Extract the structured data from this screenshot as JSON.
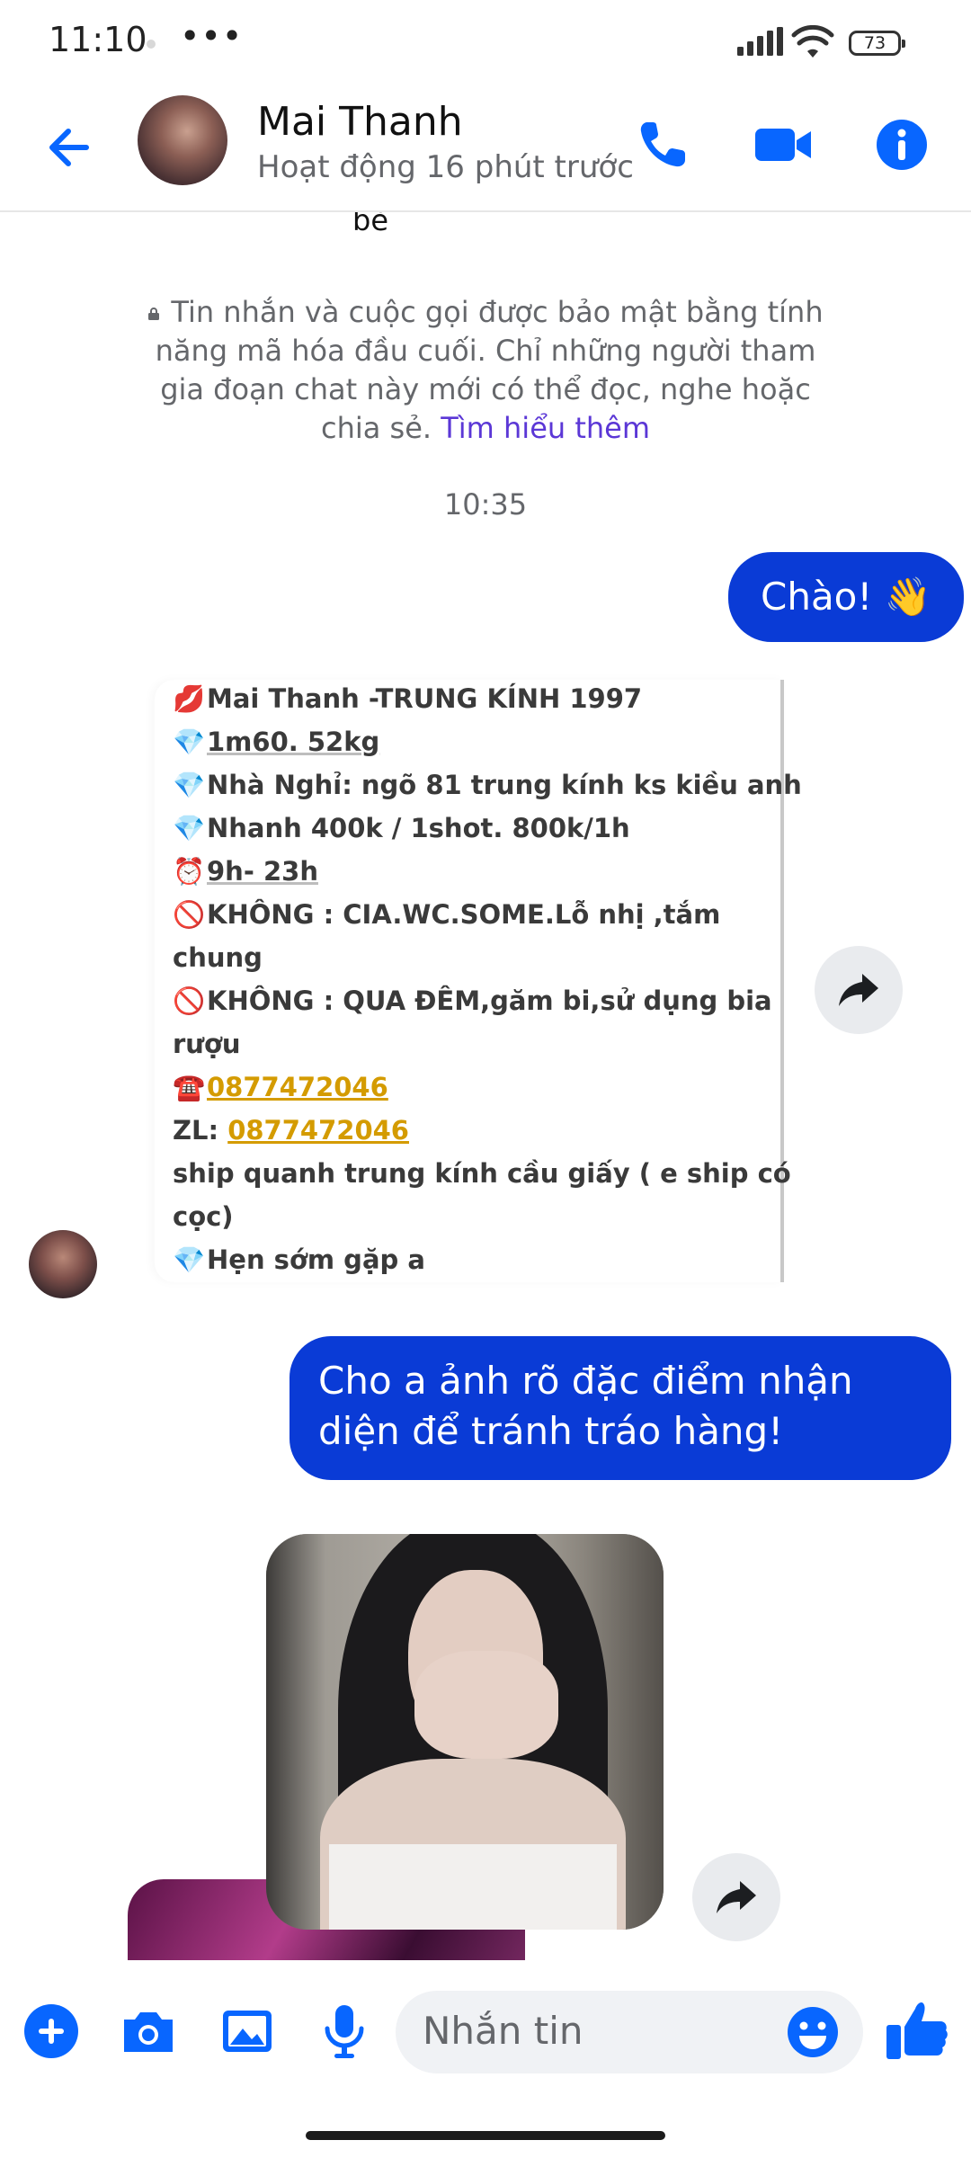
{
  "status_bar": {
    "time": "11:10",
    "more": "•••",
    "battery": "73"
  },
  "header": {
    "name": "Mai Thanh",
    "status": "Hoạt động 16 phút trước",
    "icons": [
      "back-arrow-icon",
      "phone-icon",
      "video-camera-icon",
      "info-icon"
    ]
  },
  "chat": {
    "cut_text": "bè",
    "e2e_notice": "Tin nhắn và cuộc gọi được bảo mật bằng tính năng mã hóa đầu cuối. Chỉ những người tham gia đoạn chat này mới có thể đọc, nghe hoặc chia sẻ.",
    "e2e_link": "Tìm hiểu thêm",
    "timestamp": "10:35",
    "msg_hello": "Chào! 👋",
    "forwarded_card": {
      "lines": [
        {
          "emo": "💋",
          "text": "Mai Thanh -TRUNG KÍNH 1997"
        },
        {
          "emo": "💎",
          "text": "1m60. 52kg"
        },
        {
          "emo": "💎",
          "text": "Nhà Nghỉ:  ngõ 81 trung kính ks kiều anh"
        },
        {
          "emo": "💎",
          "text": "Nhanh 400k / 1shot. 800k/1h"
        },
        {
          "emo": "⏰",
          "text": "9h- 23h"
        },
        {
          "emo": "🚫",
          "text": "KHÔNG : CIA.WC.SOME.Lỗ nhị  ,tắm"
        },
        {
          "emo": "",
          "text": "chung"
        },
        {
          "emo": "🚫",
          "text": "KHÔNG : QUA ĐÊM,găm bi,sử dụng bia"
        },
        {
          "emo": "",
          "text": "rượu"
        },
        {
          "emo": "☎️",
          "text": "0877472046"
        },
        {
          "emo": "",
          "text": "ZL: ",
          "phone": "0877472046"
        },
        {
          "emo": "",
          "text": "ship quanh trung kính cầu giấy ( e ship có"
        },
        {
          "emo": "",
          "text": "cọc)"
        },
        {
          "emo": "💎",
          "text": "Hẹn sớm gặp a"
        }
      ]
    },
    "msg_ask": "Cho a ảnh rõ đặc điểm nhận diện để tránh tráo hàng!"
  },
  "composer": {
    "placeholder": "Nhắn tin",
    "icons": [
      "plus-icon",
      "camera-icon",
      "image-icon",
      "microphone-icon",
      "emoji-icon",
      "thumbs-up-icon"
    ]
  },
  "colors": {
    "accent": "#0a3bd6",
    "icon_blue": "#0866ff",
    "link": "#5b37d6",
    "phone_link": "#d49b00"
  }
}
